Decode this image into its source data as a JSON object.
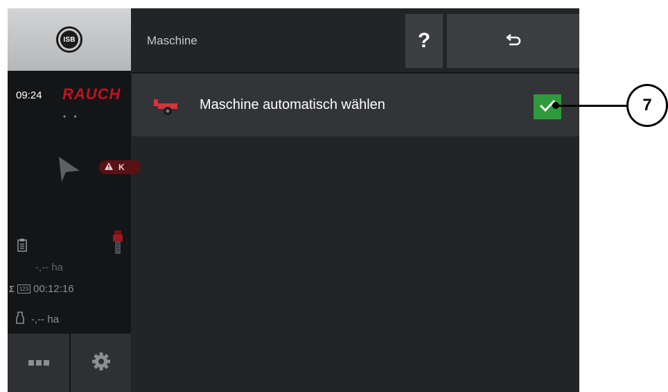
{
  "sidebar": {
    "isb_label": "ISB",
    "time": "09:24",
    "brand": "RAUCH",
    "dots": "• •",
    "warning_letter": "K",
    "area_value": "-,-- ha",
    "sigma_symbol": "Σ",
    "counter_icon_text": "123",
    "elapsed_time": "00:12:16",
    "area_value_2": "-,-- ha"
  },
  "header": {
    "title": "Maschine",
    "help_label": "?"
  },
  "list": {
    "items": [
      {
        "label": "Maschine automatisch wählen",
        "checked": true
      }
    ]
  },
  "callout": {
    "number": "7"
  },
  "colors": {
    "accent_green": "#2e9a3d",
    "brand_red": "#c1121f",
    "background": "#222426"
  }
}
